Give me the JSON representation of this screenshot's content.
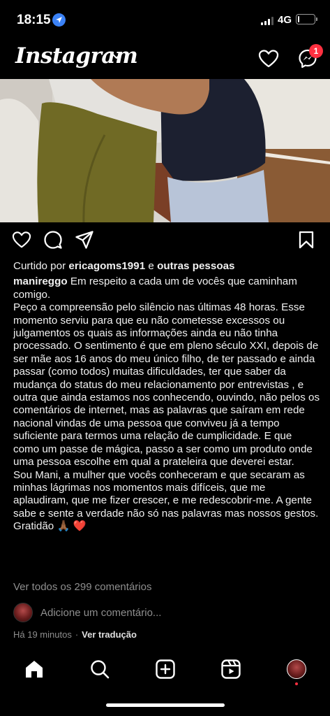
{
  "status_bar": {
    "time": "18:15",
    "network": "4G",
    "battery_level": 0.1
  },
  "header": {
    "logo": "Instagram",
    "notification_count": "1"
  },
  "post": {
    "likes": {
      "prefix": "Curtido por",
      "user": "ericagoms1991",
      "conjunction": "e",
      "others": "outras pessoas"
    },
    "caption": {
      "username": "manireggo",
      "first_line": "Em respeito a cada um de vocês que caminham comigo.",
      "paragraphs": [
        "Peço a compreensão  pelo silêncio nas últimas 48 horas. Esse momento serviu para que eu não cometesse excessos ou julgamentos os quais as informações ainda eu não tinha processado. O sentimento é que em pleno século XXI, depois de ser mãe aos 16 anos do meu único filho, de ter passado e ainda passar (como todos) muitas dificuldades, ter que saber da mudança do status do  meu relacionamento por entrevistas , e outra que ainda estamos nos conhecendo, ouvindo, não pelos os comentários de internet, mas as palavras que saíram em rede nacional vindas de uma pessoa que conviveu já a tempo suficiente para termos  uma relação de cumplicidade. E que como um passe de mágica, passo a ser  como um produto onde uma pessoa escolhe em qual a prateleira que deverei estar.",
        "Sou Mani, a mulher que vocês conheceram e que secaram as minhas lágrimas nos momentos mais difíceis, que me aplaudiram, que me fizer crescer, e me redescobrir-me. A gente sabe e sente a verdade não só nas palavras mas nossos gestos.",
        "Gratidão 🙏🏾 ❤️"
      ]
    },
    "view_comments": "Ver todos os 299 comentários",
    "add_comment_placeholder": "Adicione um comentário...",
    "time_ago": "Há 19 minutos",
    "separator": "·",
    "translate": "Ver tradução"
  },
  "icons": {
    "header": [
      "heart-icon",
      "messenger-icon"
    ],
    "actions": [
      "like-icon",
      "comment-icon",
      "share-icon",
      "bookmark-icon"
    ],
    "nav": [
      "home-icon",
      "search-icon",
      "new-post-icon",
      "reels-icon",
      "profile-avatar"
    ]
  },
  "colors": {
    "background": "#000000",
    "secondary_text": "#8e8e8e",
    "badge": "#ff3040",
    "location_blue": "#3b82f6"
  }
}
